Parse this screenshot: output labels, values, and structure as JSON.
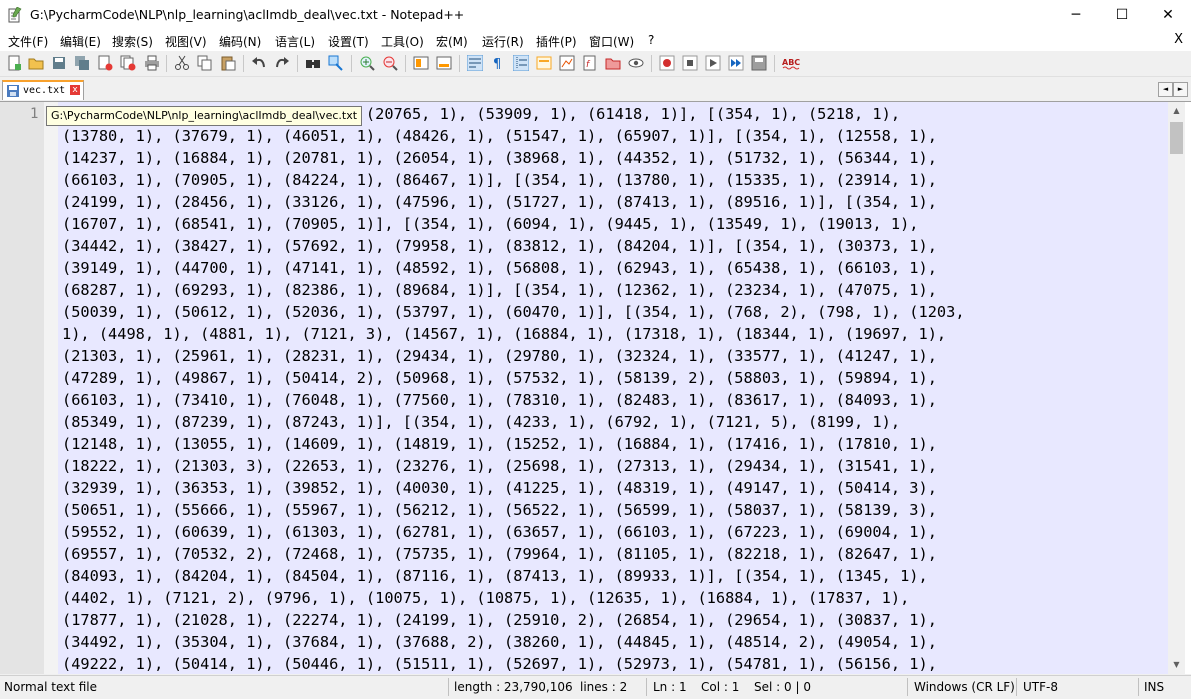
{
  "window": {
    "title": "G:\\PycharmCode\\NLP\\nlp_learning\\aclImdb_deal\\vec.txt - Notepad++",
    "minimize_glyph": "─",
    "maximize_glyph": "☐",
    "close_glyph": "✕"
  },
  "menu": {
    "items": [
      "文件(F)",
      "编辑(E)",
      "搜索(S)",
      "视图(V)",
      "编码(N)",
      "语言(L)",
      "设置(T)",
      "工具(O)",
      "宏(M)",
      "运行(R)",
      "插件(P)",
      "窗口(W)",
      "?"
    ],
    "close_glyph": "X"
  },
  "toolbar": {
    "icons": [
      "new-file",
      "open-file",
      "save",
      "save-all",
      "close",
      "close-all",
      "print",
      "cut",
      "copy",
      "paste",
      "undo",
      "redo",
      "find",
      "replace",
      "zoom-in",
      "zoom-out",
      "sync-vertical",
      "sync-horizontal",
      "word-wrap",
      "show-all-characters",
      "indent-guide",
      "user-defined-language",
      "document-map",
      "function-list",
      "folder-as-workspace",
      "monitoring",
      "record-macro",
      "stop-recording",
      "playback-macro",
      "run-macro-multiple",
      "save-macro",
      "spell-check"
    ],
    "spellcheck_label": "ABC"
  },
  "tab": {
    "label": "vec.txt",
    "close_glyph": "x",
    "tooltip": "G:\\PycharmCode\\NLP\\nlp_learning\\aclImdb_deal\\vec.txt",
    "scroll_left_glyph": "◄",
    "scroll_right_glyph": "►"
  },
  "editor": {
    "line_number": "1",
    "lines": [
      "(354, 1), (7121, 1), (24204, 1), (20765, 1), (53909, 1), (61418, 1)], [(354, 1), (5218, 1),",
      "(13780, 1), (37679, 1), (46051, 1), (48426, 1), (51547, 1), (65907, 1)], [(354, 1), (12558, 1),",
      "(14237, 1), (16884, 1), (20781, 1), (26054, 1), (38968, 1), (44352, 1), (51732, 1), (56344, 1),",
      "(66103, 1), (70905, 1), (84224, 1), (86467, 1)], [(354, 1), (13780, 1), (15335, 1), (23914, 1),",
      "(24199, 1), (28456, 1), (33126, 1), (47596, 1), (51727, 1), (87413, 1), (89516, 1)], [(354, 1),",
      "(16707, 1), (68541, 1), (70905, 1)], [(354, 1), (6094, 1), (9445, 1), (13549, 1), (19013, 1),",
      "(34442, 1), (38427, 1), (57692, 1), (79958, 1), (83812, 1), (84204, 1)], [(354, 1), (30373, 1),",
      "(39149, 1), (44700, 1), (47141, 1), (48592, 1), (56808, 1), (62943, 1), (65438, 1), (66103, 1),",
      "(68287, 1), (69293, 1), (82386, 1), (89684, 1)], [(354, 1), (12362, 1), (23234, 1), (47075, 1),",
      "(50039, 1), (50612, 1), (52036, 1), (53797, 1), (60470, 1)], [(354, 1), (768, 2), (798, 1), (1203,",
      "1), (4498, 1), (4881, 1), (7121, 3), (14567, 1), (16884, 1), (17318, 1), (18344, 1), (19697, 1),",
      "(21303, 1), (25961, 1), (28231, 1), (29434, 1), (29780, 1), (32324, 1), (33577, 1), (41247, 1),",
      "(47289, 1), (49867, 1), (50414, 2), (50968, 1), (57532, 1), (58139, 2), (58803, 1), (59894, 1),",
      "(66103, 1), (73410, 1), (76048, 1), (77560, 1), (78310, 1), (82483, 1), (83617, 1), (84093, 1),",
      "(85349, 1), (87239, 1), (87243, 1)], [(354, 1), (4233, 1), (6792, 1), (7121, 5), (8199, 1),",
      "(12148, 1), (13055, 1), (14609, 1), (14819, 1), (15252, 1), (16884, 1), (17416, 1), (17810, 1),",
      "(18222, 1), (21303, 3), (22653, 1), (23276, 1), (25698, 1), (27313, 1), (29434, 1), (31541, 1),",
      "(32939, 1), (36353, 1), (39852, 1), (40030, 1), (41225, 1), (48319, 1), (49147, 1), (50414, 3),",
      "(50651, 1), (55666, 1), (55967, 1), (56212, 1), (56522, 1), (56599, 1), (58037, 1), (58139, 3),",
      "(59552, 1), (60639, 1), (61303, 1), (62781, 1), (63657, 1), (66103, 1), (67223, 1), (69004, 1),",
      "(69557, 1), (70532, 2), (72468, 1), (75735, 1), (79964, 1), (81105, 1), (82218, 1), (82647, 1),",
      "(84093, 1), (84204, 1), (84504, 1), (87116, 1), (87413, 1), (89933, 1)], [(354, 1), (1345, 1),",
      "(4402, 1), (7121, 2), (9796, 1), (10075, 1), (10875, 1), (12635, 1), (16884, 1), (17837, 1),",
      "(17877, 1), (21028, 1), (22274, 1), (24199, 1), (25910, 2), (26854, 1), (29654, 1), (30837, 1),",
      "(34492, 1), (35304, 1), (37684, 1), (37688, 2), (38260, 1), (44845, 1), (48514, 2), (49054, 1),",
      "(49222, 1), (50414, 1), (50446, 1), (51511, 1), (52697, 1), (52973, 1), (54781, 1), (56156, 1),"
    ]
  },
  "statusbar": {
    "file_type": "Normal text file",
    "length": "length : 23,790,106",
    "lines": "lines : 2",
    "ln": "Ln : 1",
    "col": "Col : 1",
    "sel": "Sel : 0 | 0",
    "eol": "Windows (CR LF)",
    "encoding": "UTF-8",
    "mode": "INS"
  },
  "colors": {
    "selection_background": "#e8e8ff",
    "gutter_background": "#e4e4e4",
    "tab_active_accent": "#f8a12d",
    "tab_close": "#e53935"
  }
}
